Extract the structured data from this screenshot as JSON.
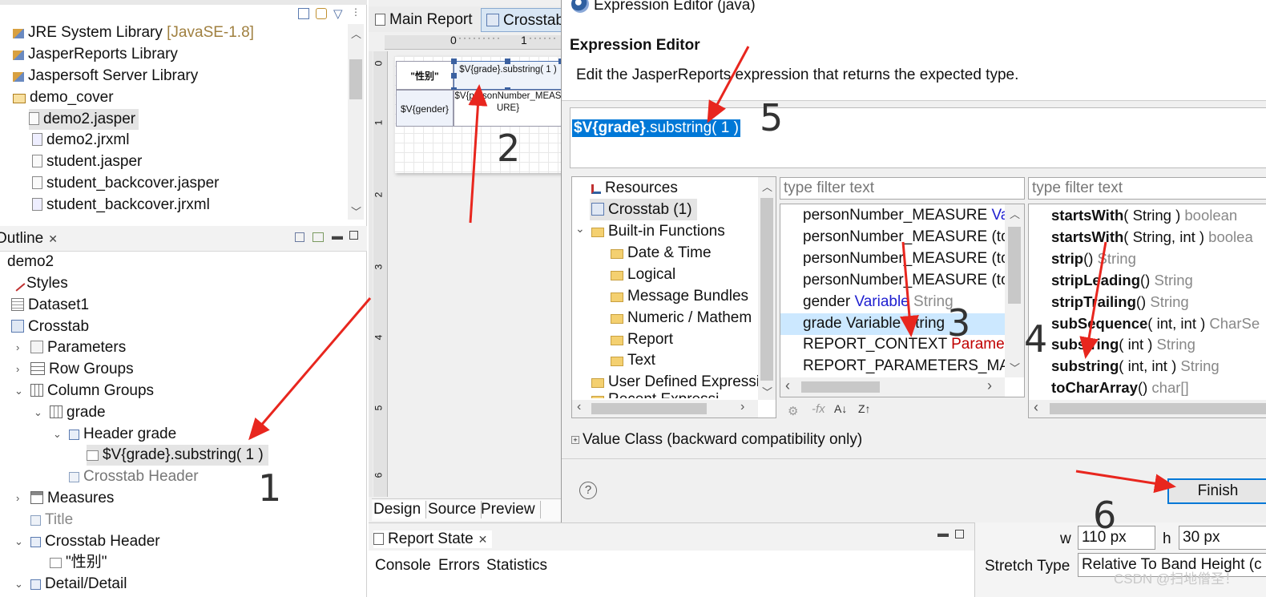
{
  "project_tree": {
    "items": [
      {
        "label": "JRE System Library",
        "suffix": " [JavaSE-1.8]",
        "icon": "library-icon"
      },
      {
        "label": "JasperReports Library",
        "icon": "library-icon"
      },
      {
        "label": "Jaspersoft Server Library",
        "icon": "library-icon"
      },
      {
        "label": "demo_cover",
        "icon": "folder-open-icon"
      },
      {
        "label": "demo2.jasper",
        "icon": "jasper-file-icon"
      },
      {
        "label": "demo2.jrxml",
        "icon": "jrxml-file-icon"
      },
      {
        "label": "student.jasper",
        "icon": "jasper-file-icon"
      },
      {
        "label": "student_backcover.jasper",
        "icon": "jasper-file-icon"
      },
      {
        "label": "student_backcover.jrxml",
        "icon": "jrxml-file-icon"
      }
    ]
  },
  "outline": {
    "tab_label": "Outline",
    "items": [
      {
        "label": "demo2"
      },
      {
        "label": "Styles"
      },
      {
        "label": "Dataset1"
      },
      {
        "label": "Crosstab"
      },
      {
        "label": "Parameters"
      },
      {
        "label": "Row Groups"
      },
      {
        "label": "Column Groups"
      },
      {
        "label": "grade"
      },
      {
        "label": "Header grade"
      },
      {
        "label": "$V{grade}.substring( 1 )"
      },
      {
        "label": "Crosstab Header"
      },
      {
        "label": "Measures"
      },
      {
        "label": "Title"
      },
      {
        "label": "Crosstab Header"
      },
      {
        "label": "\"性别\""
      },
      {
        "label": "Detail/Detail"
      }
    ]
  },
  "editor": {
    "tabs": [
      "Main Report",
      "Crosstab"
    ],
    "ruler_labels": [
      "0",
      "1"
    ],
    "vruler_labels": [
      "0",
      "1",
      "2",
      "3",
      "4",
      "5",
      "6"
    ],
    "cells": {
      "header_sex": "\"性别\"",
      "header_grade": "$V{grade}.substring( 1 )",
      "gender": "$V{gender}",
      "measure": "$V{personNumber_MEASURE}"
    },
    "bottom_tabs": [
      "Design",
      "Source",
      "Preview"
    ]
  },
  "report_state": {
    "title": "Report State",
    "tabs": [
      "Console",
      "Errors",
      "Statistics"
    ]
  },
  "properties": {
    "w_label": "w",
    "w_value": "110 px",
    "h_label": "h",
    "h_value": "30 px",
    "stretch_label": "Stretch Type",
    "stretch_value": "Relative To Band Height (c"
  },
  "dialog": {
    "window_title": "Expression Editor (java)",
    "heading": "Expression Editor",
    "description": "Edit the JasperReports expression that returns the expected type.",
    "expression_var": "$V{grade}",
    "expression_rest": ".substring( 1 )",
    "categories": [
      {
        "label": "Resources",
        "icon": "resources-icon"
      },
      {
        "label": "Crosstab (1)",
        "icon": "crosstab-icon"
      },
      {
        "label": "Built-in Functions",
        "icon": "folder-icon"
      },
      {
        "label": "Date & Time",
        "icon": "folder-icon"
      },
      {
        "label": "Logical",
        "icon": "folder-icon"
      },
      {
        "label": "Message Bundles",
        "icon": "folder-icon"
      },
      {
        "label": "Numeric / Mathem",
        "icon": "folder-icon"
      },
      {
        "label": "Report",
        "icon": "folder-icon"
      },
      {
        "label": "Text",
        "icon": "folder-icon"
      },
      {
        "label": "User Defined Expressi",
        "icon": "folder-icon"
      },
      {
        "label": "Recent Expressi",
        "icon": "folder-icon"
      }
    ],
    "filter_placeholder": "type filter text",
    "variables": [
      {
        "name": "personNumber_MEASURE",
        "kind": " Va",
        "type": ""
      },
      {
        "name": "personNumber_MEASURE (to",
        "kind": "",
        "type": ""
      },
      {
        "name": "personNumber_MEASURE (to",
        "kind": "",
        "type": ""
      },
      {
        "name": "personNumber_MEASURE (to",
        "kind": "",
        "type": ""
      },
      {
        "name": "gender",
        "kind": " Variable",
        "type": " String"
      },
      {
        "name": "grade",
        "kind": " Variable",
        "type": " String"
      },
      {
        "name": "REPORT_CONTEXT",
        "kind": " Parameter",
        "type": ""
      },
      {
        "name": "REPORT_PARAMETERS_MAP",
        "kind": "",
        "type": ""
      }
    ],
    "methods": [
      {
        "name": "startsWith",
        "args": "( String )",
        "ret": " boolean"
      },
      {
        "name": "startsWith",
        "args": "( String, int )",
        "ret": " boolea"
      },
      {
        "name": "strip",
        "args": "()",
        "ret": " String"
      },
      {
        "name": "stripLeading",
        "args": "()",
        "ret": " String"
      },
      {
        "name": "stripTrailing",
        "args": "()",
        "ret": " String"
      },
      {
        "name": "subSequence",
        "args": "( int, int )",
        "ret": " CharSe"
      },
      {
        "name": "substring",
        "args": "( int )",
        "ret": " String"
      },
      {
        "name": "substring",
        "args": "( int, int )",
        "ret": " String"
      },
      {
        "name": "toCharArray",
        "args": "()",
        "ret": " char[]"
      }
    ],
    "value_class_label": "Value Class (backward compatibility only)",
    "finish_label": "Finish",
    "help_label": "?"
  },
  "annotations": [
    "1",
    "2",
    "3",
    "4",
    "5",
    "6"
  ],
  "watermark": "CSDN @扫地僧圣！",
  "colors": {
    "arrow": "#e8261e",
    "selection": "#0078d7",
    "selected_row": "#cce8ff",
    "variable_blue": "#2020d0",
    "parameter_red": "#c00000",
    "gray_type": "#8c8c8c"
  }
}
